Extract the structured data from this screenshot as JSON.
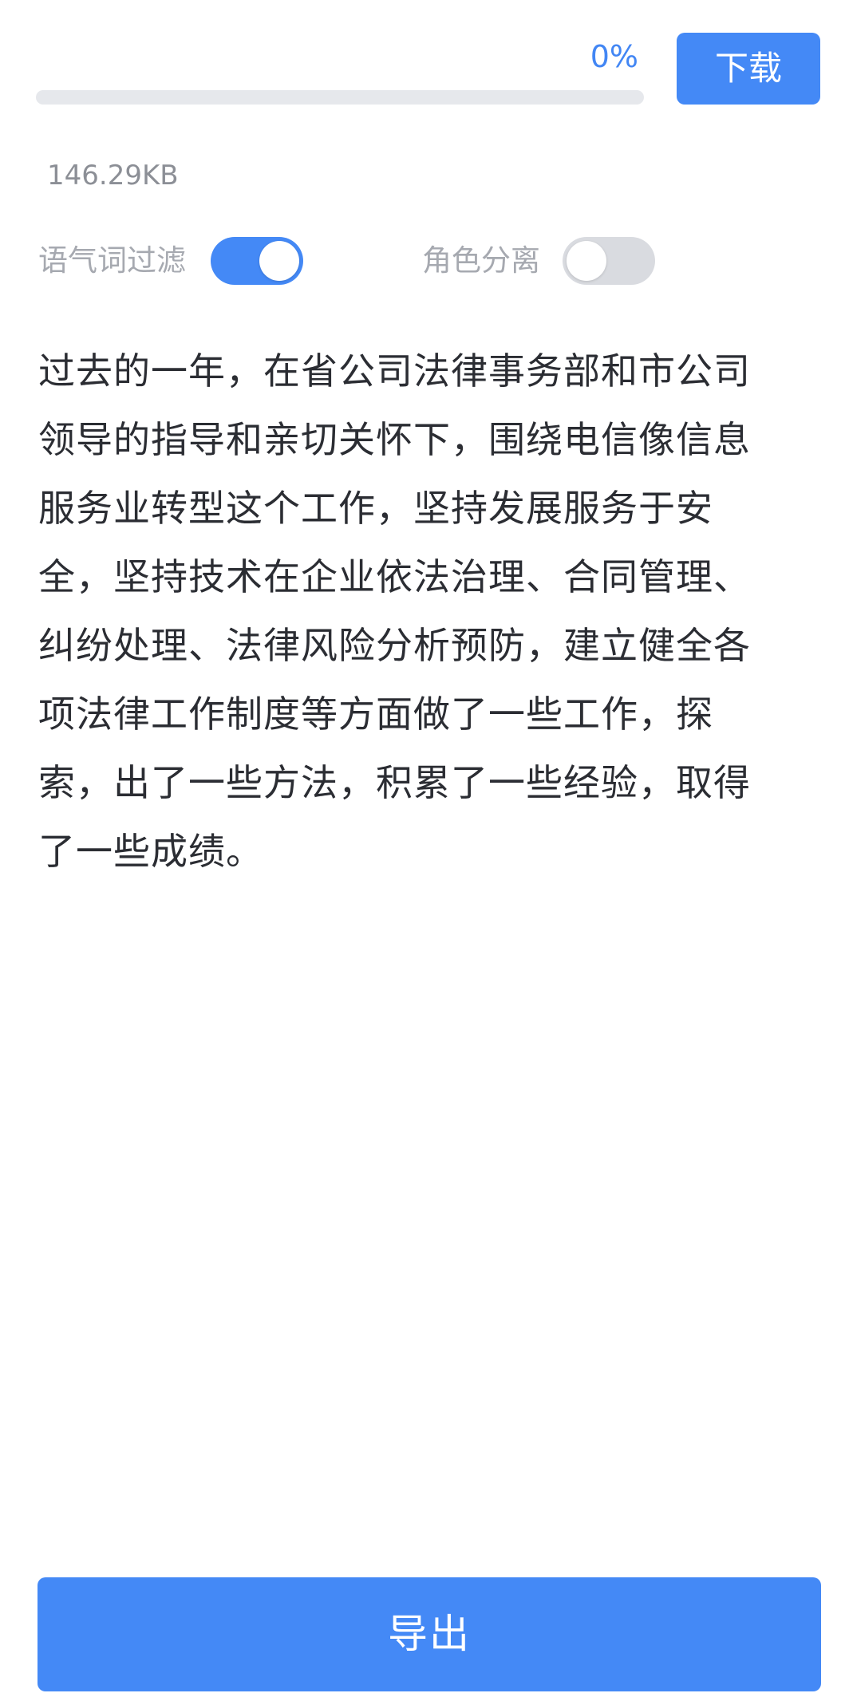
{
  "progress": {
    "percent_label": "0%",
    "value": 0
  },
  "download_button": {
    "label": "下载"
  },
  "file": {
    "size": "146.29KB"
  },
  "options": {
    "filler_filter": {
      "label": "语气词过滤",
      "enabled": true
    },
    "role_separation": {
      "label": "角色分离",
      "enabled": false
    }
  },
  "transcript": {
    "text": "过去的一年，在省公司法律事务部和市公司领导的指导和亲切关怀下，围绕电信像信息服务业转型这个工作，坚持发展服务于安全，坚持技术在企业依法治理、合同管理、纠纷处理、法律风险分析预防，建立健全各项法律工作制度等方面做了一些工作，探索，出了一些方法，积累了一些经验，取得了一些成绩。"
  },
  "export_button": {
    "label": "导出"
  },
  "colors": {
    "accent": "#4489f6",
    "switch_off": "#d9dbe0",
    "track": "#e6e8ec"
  }
}
